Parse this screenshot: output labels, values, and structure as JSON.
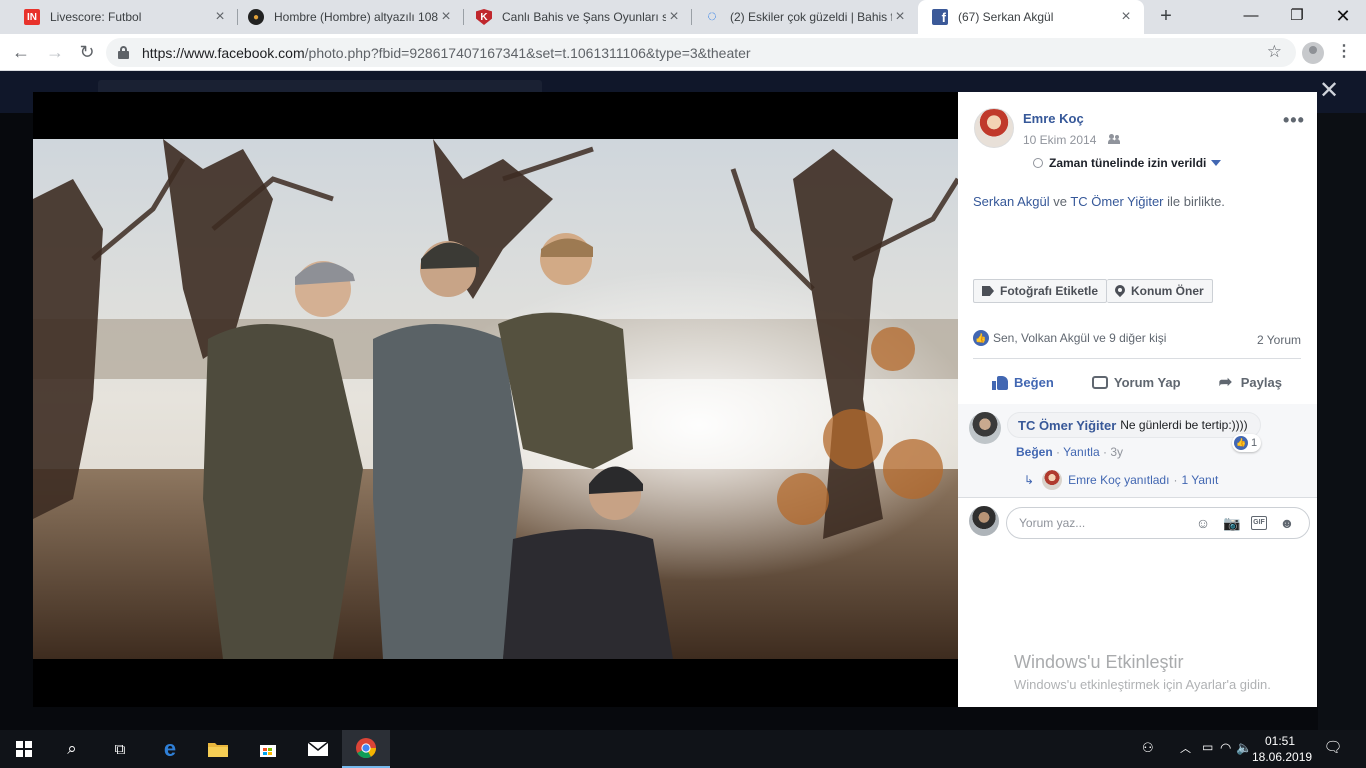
{
  "browser": {
    "tabs": [
      {
        "title": "Livescore: Futbol",
        "favicon": "IN",
        "favicon_color": "#e8322b",
        "active": false
      },
      {
        "title": "Hombre (Hombre) altyazılı 108",
        "favicon": "●",
        "favicon_color": "#d38b1b",
        "active": false
      },
      {
        "title": "Canlı Bahis ve Şans Oyunları sit",
        "favicon": "K",
        "favicon_color": "#c0272d",
        "active": false
      },
      {
        "title": "(2) Eskiler çok güzeldi | Bahis fo",
        "favicon": "◌",
        "favicon_color": "#1a73e8",
        "active": false
      },
      {
        "title": "(67) Serkan Akgül",
        "favicon": "f",
        "favicon_color": "#3b5998",
        "active": true
      }
    ],
    "new_tab": "+",
    "url_host": "https://www.facebook.com",
    "url_path": "/photo.php?fbid=928617407167341&set=t.1061311106&type=3&theater"
  },
  "post": {
    "author": "Emre Koç",
    "date": "10 Ekim 2014",
    "privacy": "Zaman tünelinde izin verildi",
    "tagged_1": "Serkan Akgül",
    "tagged_and": " ve ",
    "tagged_2": "TC Ömer Yiğiter",
    "tagged_suffix": " ile birlikte.",
    "tag_button": "Fotoğrafı Etiketle",
    "location_button": "Konum Öner",
    "reactions_text": "Sen, Volkan Akgül ve 9 diğer kişi",
    "comment_count": "2 Yorum",
    "like": "Beğen",
    "comment": "Yorum Yap",
    "share": "Paylaş"
  },
  "comment": {
    "author": "TC Ömer Yiğiter",
    "text": "Ne günlerdi be tertip:))))",
    "like_count": "1",
    "like_link": "Beğen",
    "dot": "·",
    "reply_link": "Yanıtla",
    "age": "3y",
    "reply_author": "Emre Koç yanıtladı",
    "reply_count": "1 Yanıt"
  },
  "composer": {
    "placeholder": "Yorum yaz...",
    "gif": "GIF"
  },
  "watermark": {
    "title": "Windows'u Etkinleştir",
    "subtitle": "Windows'u etkinleştirmek için Ayarlar'a gidin."
  },
  "taskbar": {
    "time": "01:51",
    "date": "18.06.2019"
  }
}
